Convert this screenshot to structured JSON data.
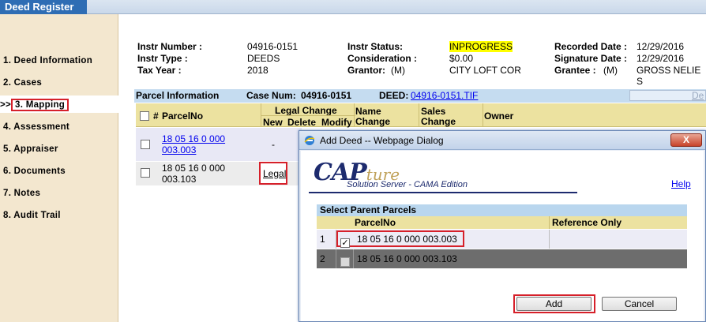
{
  "app": {
    "tab_label": "Deed Register"
  },
  "nav": {
    "marker": ">>",
    "items": [
      "1. Deed Information",
      "2. Cases",
      "3. Mapping",
      "4. Assessment",
      "5. Appraiser",
      "6. Documents",
      "7. Notes",
      "8. Audit Trail"
    ]
  },
  "header": {
    "instr_number_label": "Instr Number :",
    "instr_number": "04916-0151",
    "instr_type_label": "Instr Type :",
    "instr_type": "DEEDS",
    "tax_year_label": "Tax Year :",
    "tax_year": "2018",
    "instr_status_label": "Instr Status:",
    "instr_status": "INPROGRESS",
    "consideration_label": "Consideration :",
    "consideration": "$0.00",
    "grantor_label": "Grantor:",
    "grantor_m": "(M)",
    "grantor": "CITY LOFT COR",
    "recorded_date_label": "Recorded Date :",
    "recorded_date": "12/29/2016",
    "signature_date_label": "Signature Date :",
    "signature_date": "12/29/2016",
    "grantee_label": "Grantee :",
    "grantee_m": "(M)",
    "grantee": "GROSS NELIE S"
  },
  "parcel_info": {
    "label": "Parcel Information",
    "case_num_label": "Case Num:",
    "case_num": "04916-0151",
    "deed_label": "DEED:",
    "deed_link": "04916-0151.TIF",
    "right_cut": "De"
  },
  "grid": {
    "hash": "#",
    "parcelno_header": "ParcelNo",
    "legal_change_header": "Legal Change",
    "new_header": "New",
    "delete_header": "Delete",
    "modify_header": "Modify",
    "name_change_header1": "Name",
    "name_change_header2": "Change",
    "sales_change_header1": "Sales",
    "sales_change_header2": "Change",
    "owner_header": "Owner",
    "rows": [
      {
        "parcel_line1": "18 05 16 0 000",
        "parcel_line2": "003.003",
        "new": "-"
      },
      {
        "parcel_line1": "18 05 16 0 000",
        "parcel_line2": "003.103",
        "legal": "Legal"
      }
    ]
  },
  "dialog": {
    "title": "Add Deed -- Webpage Dialog",
    "close_label": "X",
    "logo_cap": "CAP",
    "logo_ture": "ture",
    "logo_sub": "Solution Server - CAMA Edition",
    "help": "Help",
    "section_title": "Select Parent Parcels",
    "col_parcelno": "ParcelNo",
    "col_reference": "Reference Only",
    "rows": [
      {
        "num": "1",
        "parcel": "18 05 16 0 000 003.003",
        "checked": true
      },
      {
        "num": "2",
        "parcel": "18 05 16 0 000 003.103",
        "checked": false
      }
    ],
    "add_label": "Add",
    "cancel_label": "Cancel"
  },
  "colors": {
    "tab_blue": "#2e6db4",
    "nav_bg": "#f3e7cf",
    "header_yellow": "#ece2a0",
    "highlight_red": "#d6202a",
    "status_highlight": "#ffff00"
  }
}
